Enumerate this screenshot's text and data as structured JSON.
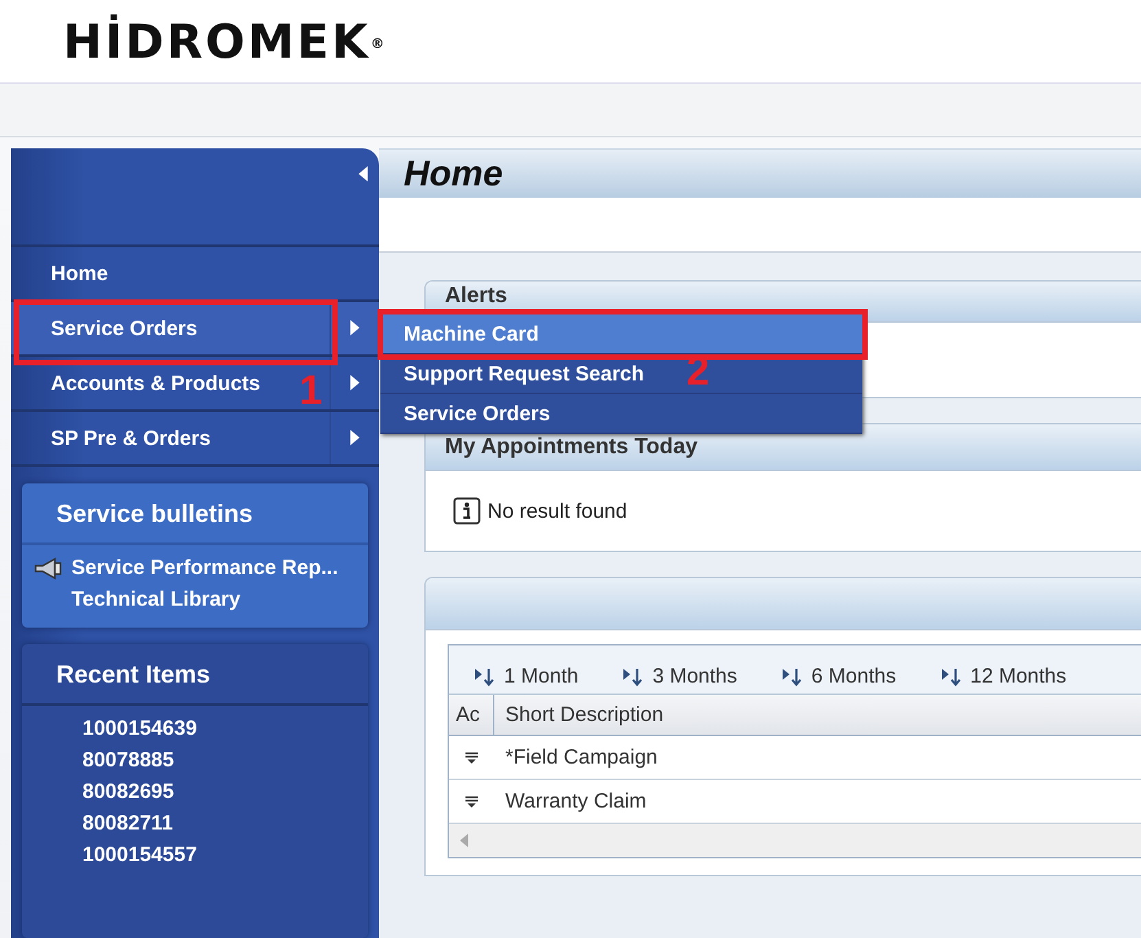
{
  "logo": {
    "name": "HİDROMEK",
    "mark": "®"
  },
  "page_title": "Home",
  "sidebar": {
    "nav": [
      {
        "label": "Home",
        "submenu": false,
        "selected": false
      },
      {
        "label": "Service Orders",
        "submenu": true,
        "selected": true,
        "callout": "1"
      },
      {
        "label": "Accounts & Products",
        "submenu": true,
        "selected": false
      },
      {
        "label": "SP Pre & Orders",
        "submenu": true,
        "selected": false
      }
    ],
    "bulletins": {
      "title": "Service bulletins",
      "items": [
        {
          "label": "Service Performance Rep...",
          "kind": "megaphone"
        },
        {
          "label": "Technical Library",
          "kind": "plain"
        }
      ]
    },
    "recent": {
      "title": "Recent Items",
      "items": [
        "1000154639",
        "80078885",
        "80082695",
        "80082711",
        "1000154557"
      ]
    }
  },
  "flyout_menu": [
    {
      "label": "Machine Card",
      "selected": true,
      "callout": "2"
    },
    {
      "label": "Support Request Search",
      "selected": false
    },
    {
      "label": "Service Orders",
      "selected": false
    }
  ],
  "panels": {
    "alerts": {
      "title": "Alerts"
    },
    "appointments": {
      "title": "My Appointments Today",
      "message": "No result found"
    },
    "table": {
      "filters": [
        "1 Month",
        "3 Months",
        "6 Months",
        "12 Months"
      ],
      "columns": [
        "Ac",
        "Short Description"
      ],
      "rows": [
        "*Field Campaign",
        "Warranty Claim"
      ]
    }
  }
}
